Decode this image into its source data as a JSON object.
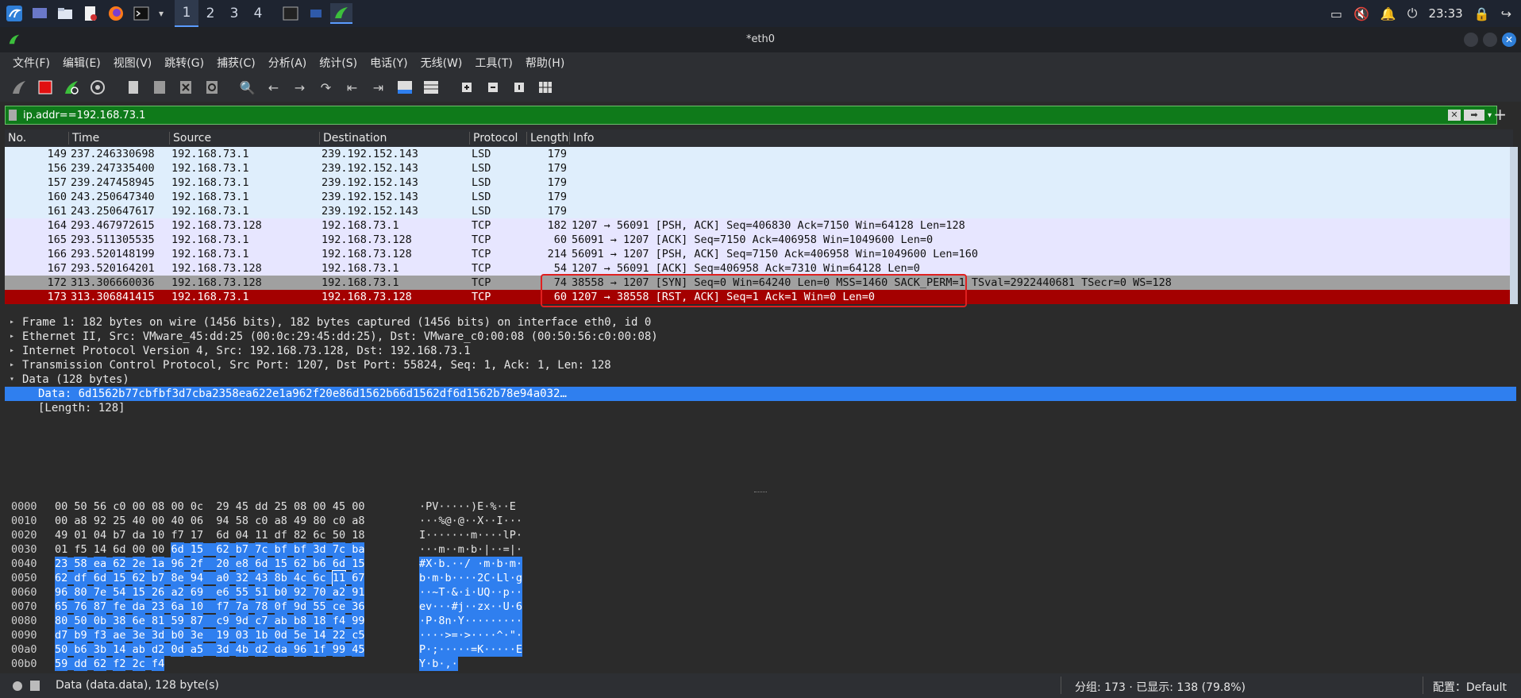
{
  "taskbar": {
    "workspaces": [
      "1",
      "2",
      "3",
      "4"
    ],
    "clock": "23:33"
  },
  "window": {
    "title": "*eth0"
  },
  "menu": [
    "文件(F)",
    "编辑(E)",
    "视图(V)",
    "跳转(G)",
    "捕获(C)",
    "分析(A)",
    "统计(S)",
    "电话(Y)",
    "无线(W)",
    "工具(T)",
    "帮助(H)"
  ],
  "filter": {
    "value": "ip.addr==192.168.73.1",
    "plus": "+"
  },
  "packet_list": {
    "headers": {
      "no": "No.",
      "time": "Time",
      "source": "Source",
      "destination": "Destination",
      "protocol": "Protocol",
      "length": "Length",
      "info": "Info"
    },
    "rows": [
      {
        "no": "149",
        "time": "237.246330698",
        "src": "192.168.73.1",
        "dst": "239.192.152.143",
        "proto": "LSD",
        "len": "179",
        "info": "",
        "style": "lsd"
      },
      {
        "no": "156",
        "time": "239.247335400",
        "src": "192.168.73.1",
        "dst": "239.192.152.143",
        "proto": "LSD",
        "len": "179",
        "info": "",
        "style": "lsd"
      },
      {
        "no": "157",
        "time": "239.247458945",
        "src": "192.168.73.1",
        "dst": "239.192.152.143",
        "proto": "LSD",
        "len": "179",
        "info": "",
        "style": "lsd"
      },
      {
        "no": "160",
        "time": "243.250647340",
        "src": "192.168.73.1",
        "dst": "239.192.152.143",
        "proto": "LSD",
        "len": "179",
        "info": "",
        "style": "lsd"
      },
      {
        "no": "161",
        "time": "243.250647617",
        "src": "192.168.73.1",
        "dst": "239.192.152.143",
        "proto": "LSD",
        "len": "179",
        "info": "",
        "style": "lsd"
      },
      {
        "no": "164",
        "time": "293.467972615",
        "src": "192.168.73.128",
        "dst": "192.168.73.1",
        "proto": "TCP",
        "len": "182",
        "info": "1207 → 56091 [PSH, ACK] Seq=406830 Ack=7150 Win=64128 Len=128",
        "style": "tcp"
      },
      {
        "no": "165",
        "time": "293.511305535",
        "src": "192.168.73.1",
        "dst": "192.168.73.128",
        "proto": "TCP",
        "len": "60",
        "info": "56091 → 1207 [ACK] Seq=7150 Ack=406958 Win=1049600 Len=0",
        "style": "tcp"
      },
      {
        "no": "166",
        "time": "293.520148199",
        "src": "192.168.73.1",
        "dst": "192.168.73.128",
        "proto": "TCP",
        "len": "214",
        "info": "56091 → 1207 [PSH, ACK] Seq=7150 Ack=406958 Win=1049600 Len=160",
        "style": "tcp"
      },
      {
        "no": "167",
        "time": "293.520164201",
        "src": "192.168.73.128",
        "dst": "192.168.73.1",
        "proto": "TCP",
        "len": "54",
        "info": "1207 → 56091 [ACK] Seq=406958 Ack=7310 Win=64128 Len=0",
        "style": "tcp"
      },
      {
        "no": "172",
        "time": "313.306660036",
        "src": "192.168.73.128",
        "dst": "192.168.73.1",
        "proto": "TCP",
        "len": "74",
        "info": "38558 → 1207 [SYN] Seq=0 Win=64240 Len=0 MSS=1460 SACK_PERM=1 TSval=2922440681 TSecr=0 WS=128",
        "style": "syn"
      },
      {
        "no": "173",
        "time": "313.306841415",
        "src": "192.168.73.1",
        "dst": "192.168.73.128",
        "proto": "TCP",
        "len": "60",
        "info": "1207 → 38558 [RST, ACK] Seq=1 Ack=1 Win=0 Len=0",
        "style": "rst"
      }
    ]
  },
  "details": [
    {
      "text": "Frame 1: 182 bytes on wire (1456 bits), 182 bytes captured (1456 bits) on interface eth0, id 0",
      "arrow": "▸",
      "child": false,
      "selected": false
    },
    {
      "text": "Ethernet II, Src: VMware_45:dd:25 (00:0c:29:45:dd:25), Dst: VMware_c0:00:08 (00:50:56:c0:00:08)",
      "arrow": "▸",
      "child": false,
      "selected": false
    },
    {
      "text": "Internet Protocol Version 4, Src: 192.168.73.128, Dst: 192.168.73.1",
      "arrow": "▸",
      "child": false,
      "selected": false
    },
    {
      "text": "Transmission Control Protocol, Src Port: 1207, Dst Port: 55824, Seq: 1, Ack: 1, Len: 128",
      "arrow": "▸",
      "child": false,
      "selected": false
    },
    {
      "text": "Data (128 bytes)",
      "arrow": "▾",
      "child": false,
      "selected": false
    },
    {
      "text": "Data: 6d1562b77cbfbf3d7cba2358ea622e1a962f20e86d1562b66d1562df6d1562b78e94a032…",
      "arrow": "",
      "child": true,
      "selected": true
    },
    {
      "text": "[Length: 128]",
      "arrow": "",
      "child": true,
      "selected": false
    }
  ],
  "hex": [
    {
      "off": "0000",
      "bytes": [
        "00",
        "50",
        "56",
        "c0",
        "00",
        "08",
        "00",
        "0c",
        "29",
        "45",
        "dd",
        "25",
        "08",
        "00",
        "45",
        "00"
      ],
      "sel_from": 99,
      "ascii": "·PV·····)E·%··E"
    },
    {
      "off": "0010",
      "bytes": [
        "00",
        "a8",
        "92",
        "25",
        "40",
        "00",
        "40",
        "06",
        "94",
        "58",
        "c0",
        "a8",
        "49",
        "80",
        "c0",
        "a8"
      ],
      "sel_from": 99,
      "ascii": "···%@·@··X··I···"
    },
    {
      "off": "0020",
      "bytes": [
        "49",
        "01",
        "04",
        "b7",
        "da",
        "10",
        "f7",
        "17",
        "6d",
        "04",
        "11",
        "df",
        "82",
        "6c",
        "50",
        "18"
      ],
      "sel_from": 99,
      "ascii": "I·······m····lP·"
    },
    {
      "off": "0030",
      "bytes": [
        "01",
        "f5",
        "14",
        "6d",
        "00",
        "00",
        "6d",
        "15",
        "62",
        "b7",
        "7c",
        "bf",
        "bf",
        "3d",
        "7c",
        "ba"
      ],
      "sel_from": 6,
      "ascii": "···m··m·b·|··=|·"
    },
    {
      "off": "0040",
      "bytes": [
        "23",
        "58",
        "ea",
        "62",
        "2e",
        "1a",
        "96",
        "2f",
        "20",
        "e8",
        "6d",
        "15",
        "62",
        "b6",
        "6d",
        "15"
      ],
      "sel_from": 0,
      "ascii": "#X·b.··/ ·m·b·m·"
    },
    {
      "off": "0050",
      "bytes": [
        "62",
        "df",
        "6d",
        "15",
        "62",
        "b7",
        "8e",
        "94",
        "a0",
        "32",
        "43",
        "8b",
        "4c",
        "6c",
        "11",
        "67"
      ],
      "sel_from": 0,
      "ascii": "b·m·b····2C·Ll·g"
    },
    {
      "off": "0060",
      "bytes": [
        "96",
        "80",
        "7e",
        "54",
        "15",
        "26",
        "a2",
        "69",
        "e6",
        "55",
        "51",
        "b0",
        "92",
        "70",
        "a2",
        "91"
      ],
      "sel_from": 0,
      "ascii": "··~T·&·i·UQ··p··"
    },
    {
      "off": "0070",
      "bytes": [
        "65",
        "76",
        "87",
        "fe",
        "da",
        "23",
        "6a",
        "10",
        "f7",
        "7a",
        "78",
        "0f",
        "9d",
        "55",
        "ce",
        "36"
      ],
      "sel_from": 0,
      "ascii": "ev···#j··zx··U·6"
    },
    {
      "off": "0080",
      "bytes": [
        "80",
        "50",
        "0b",
        "38",
        "6e",
        "81",
        "59",
        "87",
        "c9",
        "9d",
        "c7",
        "ab",
        "b8",
        "18",
        "f4",
        "99"
      ],
      "sel_from": 0,
      "ascii": "·P·8n·Y·········"
    },
    {
      "off": "0090",
      "bytes": [
        "d7",
        "b9",
        "f3",
        "ae",
        "3e",
        "3d",
        "b0",
        "3e",
        "19",
        "03",
        "1b",
        "0d",
        "5e",
        "14",
        "22",
        "c5"
      ],
      "sel_from": 0,
      "ascii": "····>=·>····^·\"·"
    },
    {
      "off": "00a0",
      "bytes": [
        "50",
        "b6",
        "3b",
        "14",
        "ab",
        "d2",
        "0d",
        "a5",
        "3d",
        "4b",
        "d2",
        "da",
        "96",
        "1f",
        "99",
        "45"
      ],
      "sel_from": 0,
      "ascii": "P·;·····=K·····E"
    },
    {
      "off": "00b0",
      "bytes": [
        "59",
        "dd",
        "62",
        "f2",
        "2c",
        "f4"
      ],
      "sel_from": 0,
      "ascii": "Y·b·,·"
    }
  ],
  "status": {
    "left": "Data (data.data), 128 byte(s)",
    "middle": "分组: 173 · 已显示: 138 (79.8%)",
    "right": "配置：Default"
  },
  "colors": {
    "filter_ok": "#0f7a1a",
    "selected": "#2f7fef",
    "rst_row": "#a40000",
    "syn_row": "#a0a0a0"
  }
}
